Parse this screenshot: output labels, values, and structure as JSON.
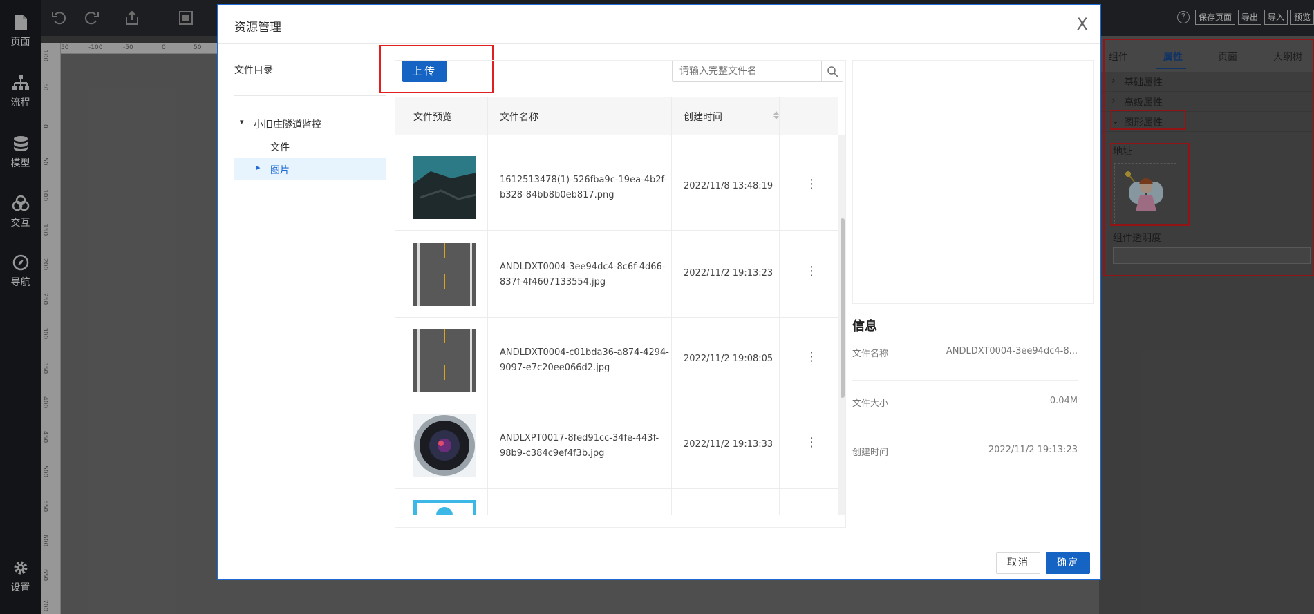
{
  "sidebar": {
    "items": [
      {
        "label": "页面",
        "icon": "file-icon"
      },
      {
        "label": "流程",
        "icon": "flow-icon"
      },
      {
        "label": "模型",
        "icon": "database-icon"
      },
      {
        "label": "交互",
        "icon": "interact-icon"
      },
      {
        "label": "导航",
        "icon": "compass-icon"
      }
    ],
    "settings": {
      "label": "设置",
      "icon": "gear-icon"
    }
  },
  "toolbar": {
    "help": "?",
    "save": "保存页面",
    "export": "导出",
    "import": "导入",
    "preview": "预览"
  },
  "ruler": {
    "h_ticks": [
      "50",
      "-100",
      "-50",
      "0",
      "50"
    ],
    "v_ticks": [
      "100",
      "50",
      "0",
      "50",
      "100",
      "150",
      "200",
      "250",
      "300",
      "350",
      "400",
      "450",
      "500",
      "550",
      "600",
      "650",
      "700"
    ]
  },
  "right_panel": {
    "tabs": [
      "组件",
      "属性",
      "页面",
      "大纲树"
    ],
    "active_tab": "属性",
    "sections": [
      "基础属性",
      "高级属性",
      "图形属性"
    ],
    "address_label": "地址",
    "opacity_label": "组件透明度"
  },
  "modal": {
    "title": "资源管理",
    "close": "X",
    "dir_title": "文件目录",
    "tree": [
      {
        "label": "小旧庄隧道监控",
        "arrow": "▾"
      },
      {
        "label": "文件",
        "arrow": ""
      },
      {
        "label": "图片",
        "arrow": "▸"
      }
    ],
    "upload": "上传",
    "search_placeholder": "请输入完整文件名",
    "table": {
      "headers": [
        "文件预览",
        "文件名称",
        "创建时间"
      ],
      "rows": [
        {
          "name": "1612513478(1)-526fba9c-19ea-4b2f-b328-84bb8b0eb817.png",
          "date": "2022/11/8 13:48:19",
          "thumb": "rock"
        },
        {
          "name": "ANDLDXT0004-3ee94dc4-8c6f-4d66-837f-4f4607133554.jpg",
          "date": "2022/11/2 19:13:23",
          "thumb": "road"
        },
        {
          "name": "ANDLDXT0004-c01bda36-a874-4294-9097-e7c20ee066d2.jpg",
          "date": "2022/11/2 19:08:05",
          "thumb": "road"
        },
        {
          "name": "ANDLXPT0017-8fed91cc-34fe-443f-98b9-c384c9ef4f3b.jpg",
          "date": "2022/11/2 19:13:33",
          "thumb": "lens"
        }
      ],
      "more": "⋮"
    },
    "info": {
      "title": "信息",
      "rows": [
        {
          "key": "文件名称",
          "value": "ANDLDXT0004-3ee94dc4-8..."
        },
        {
          "key": "文件大小",
          "value": "0.04M"
        },
        {
          "key": "创建时间",
          "value": "2022/11/2 19:13:23"
        }
      ]
    },
    "cancel": "取消",
    "ok": "确定"
  },
  "colors": {
    "accent": "#1563c2",
    "highlight": "#e02020",
    "sidebar": "#1d2024"
  }
}
